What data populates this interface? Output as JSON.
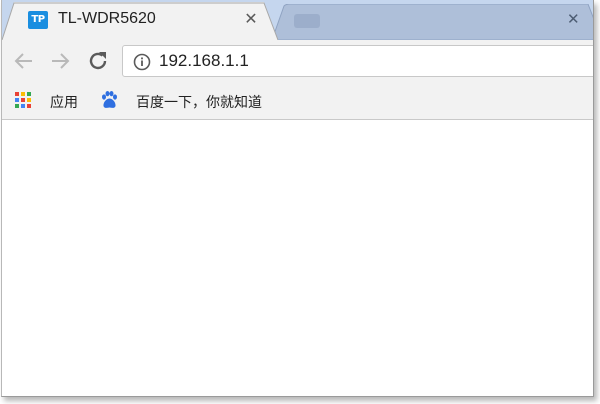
{
  "tabs": [
    {
      "title": "TL-WDR5620",
      "favicon_text": "TP",
      "active": true
    },
    {
      "title": "",
      "active": false
    }
  ],
  "address_bar": {
    "url": "192.168.1.1"
  },
  "bookmarks": [
    {
      "label": "应用",
      "icon": "apps-grid-icon"
    },
    {
      "label": "百度一下，你就知道",
      "icon": "baidu-paw-icon"
    }
  ],
  "icons": {
    "back": "arrow-left-icon",
    "forward": "arrow-right-icon",
    "reload": "reload-icon",
    "info": "info-icon",
    "close": "close-icon"
  },
  "colors": {
    "tab_strip": "#c5d6ee",
    "active_tab": "#f2f2f2",
    "tp_logo": "#1a8ee0",
    "baidu_blue": "#2f6fe0"
  }
}
